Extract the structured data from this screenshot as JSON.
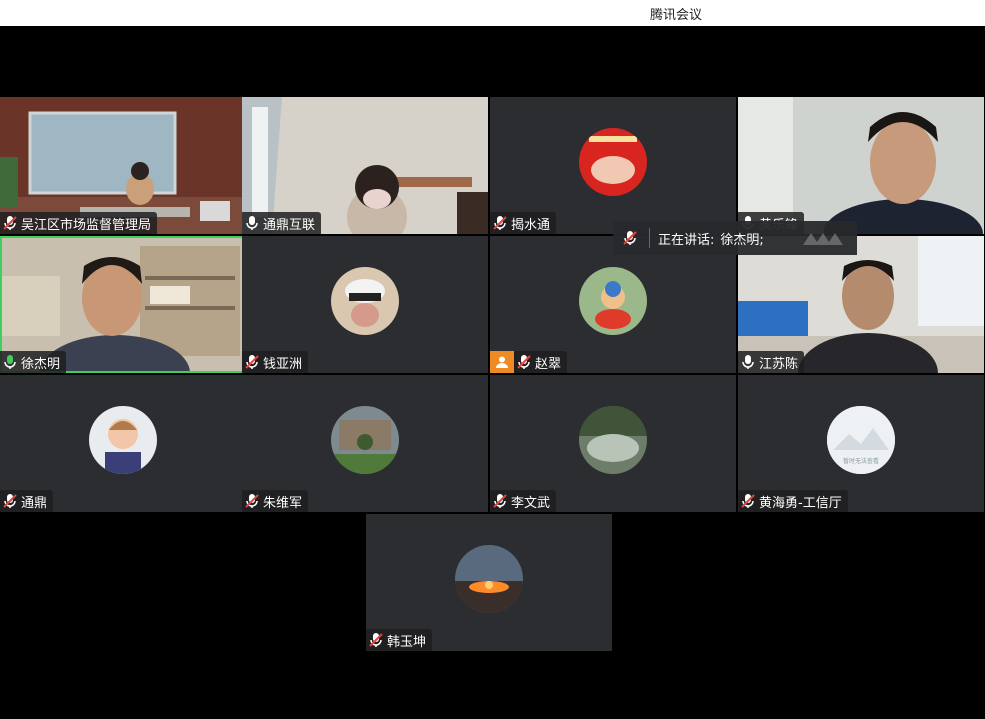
{
  "window": {
    "title": "腾讯会议"
  },
  "speaking": {
    "label": "正在讲话:",
    "names": "徐杰明;"
  },
  "participants": [
    {
      "name": "吴江区市场监督管理局",
      "mic": "muted",
      "view": "video"
    },
    {
      "name": "通鼎互联",
      "mic": "on",
      "view": "video"
    },
    {
      "name": "揭水通",
      "mic": "muted",
      "view": "avatar"
    },
    {
      "name": "黄乐锋",
      "mic": "on",
      "view": "video"
    },
    {
      "name": "徐杰明",
      "mic": "speaking",
      "view": "video"
    },
    {
      "name": "钱亚洲",
      "mic": "muted",
      "view": "avatar"
    },
    {
      "name": "赵翠",
      "mic": "muted",
      "view": "avatar"
    },
    {
      "name": "江苏陈",
      "mic": "on",
      "view": "video"
    },
    {
      "name": "通鼎",
      "mic": "muted",
      "view": "avatar"
    },
    {
      "name": "朱维军",
      "mic": "muted",
      "view": "avatar"
    },
    {
      "name": "李文武",
      "mic": "muted",
      "view": "avatar"
    },
    {
      "name": "黄海勇-工信厅",
      "mic": "muted",
      "view": "avatar"
    },
    {
      "name": "韩玉坤",
      "mic": "muted",
      "view": "avatar"
    }
  ],
  "placeholder_avatar_text": "暂时无法查看",
  "colors": {
    "accent_green": "#3ecf5e",
    "muted_red": "#e0443c",
    "user_badge": "#f08a24"
  }
}
